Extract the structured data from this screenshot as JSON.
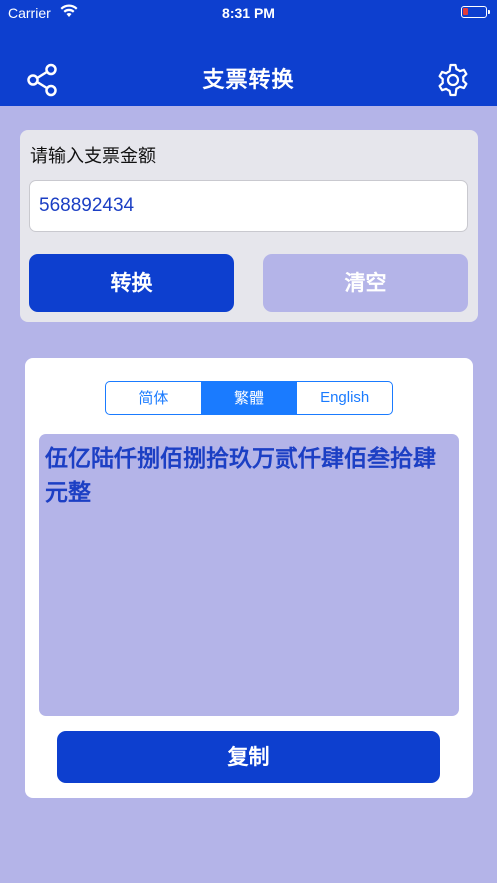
{
  "status_bar": {
    "carrier": "Carrier",
    "time": "8:31 PM",
    "battery_color": "#e23b3b"
  },
  "nav": {
    "title": "支票转换",
    "left_icon": "share-icon",
    "right_icon": "gear-icon"
  },
  "input_card": {
    "label": "请输入支票金额",
    "amount_value": "568892434",
    "convert_label": "转换",
    "clear_label": "清空"
  },
  "result_card": {
    "tabs": [
      {
        "label": "简体",
        "selected": false
      },
      {
        "label": "繁體",
        "selected": true
      },
      {
        "label": "English",
        "selected": false
      }
    ],
    "result_text": "伍亿陆仟捌佰捌拾玖万贰仟肆佰叁拾肆元整",
    "copy_label": "复制"
  },
  "colors": {
    "primary": "#0d3fcf",
    "background": "#b4b4e8",
    "segment_accent": "#1a7bff",
    "result_text": "#1c3fc4"
  }
}
